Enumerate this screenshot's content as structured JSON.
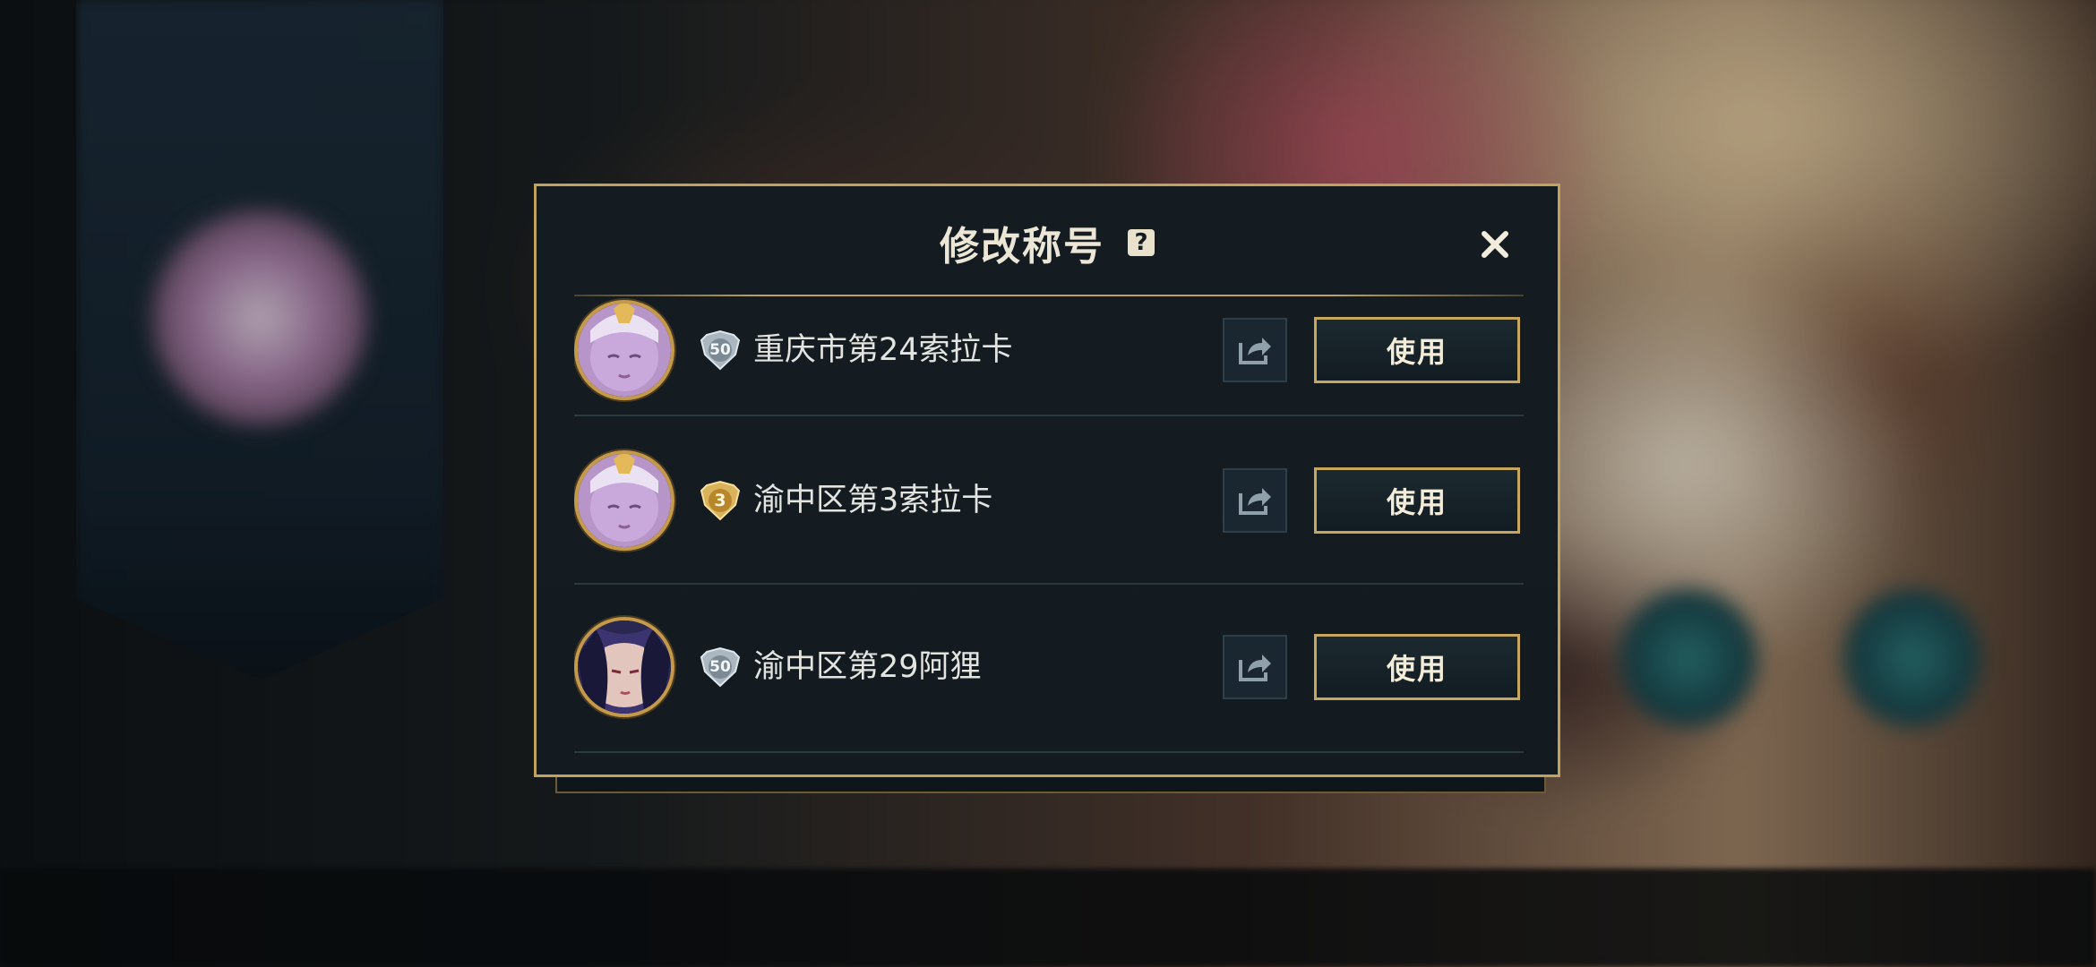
{
  "dialog": {
    "title": "修改称号",
    "help_glyph": "?",
    "close_label": "×"
  },
  "rows": [
    {
      "avatar": "soraka-avatar",
      "badge_icon": "shield-badge-silver",
      "badge_number": "50",
      "title": "重庆市第24索拉卡",
      "use_label": "使用"
    },
    {
      "avatar": "soraka-avatar",
      "badge_icon": "shield-badge-gold",
      "badge_number": "3",
      "title": "渝中区第3索拉卡",
      "use_label": "使用"
    },
    {
      "avatar": "ahri-avatar",
      "badge_icon": "shield-badge-silver",
      "badge_number": "50",
      "title": "渝中区第29阿狸",
      "use_label": "使用"
    }
  ],
  "colors": {
    "accent_gold": "#bfa25e",
    "dialog_bg": "#141c22",
    "text_light": "#e3e4e0"
  }
}
